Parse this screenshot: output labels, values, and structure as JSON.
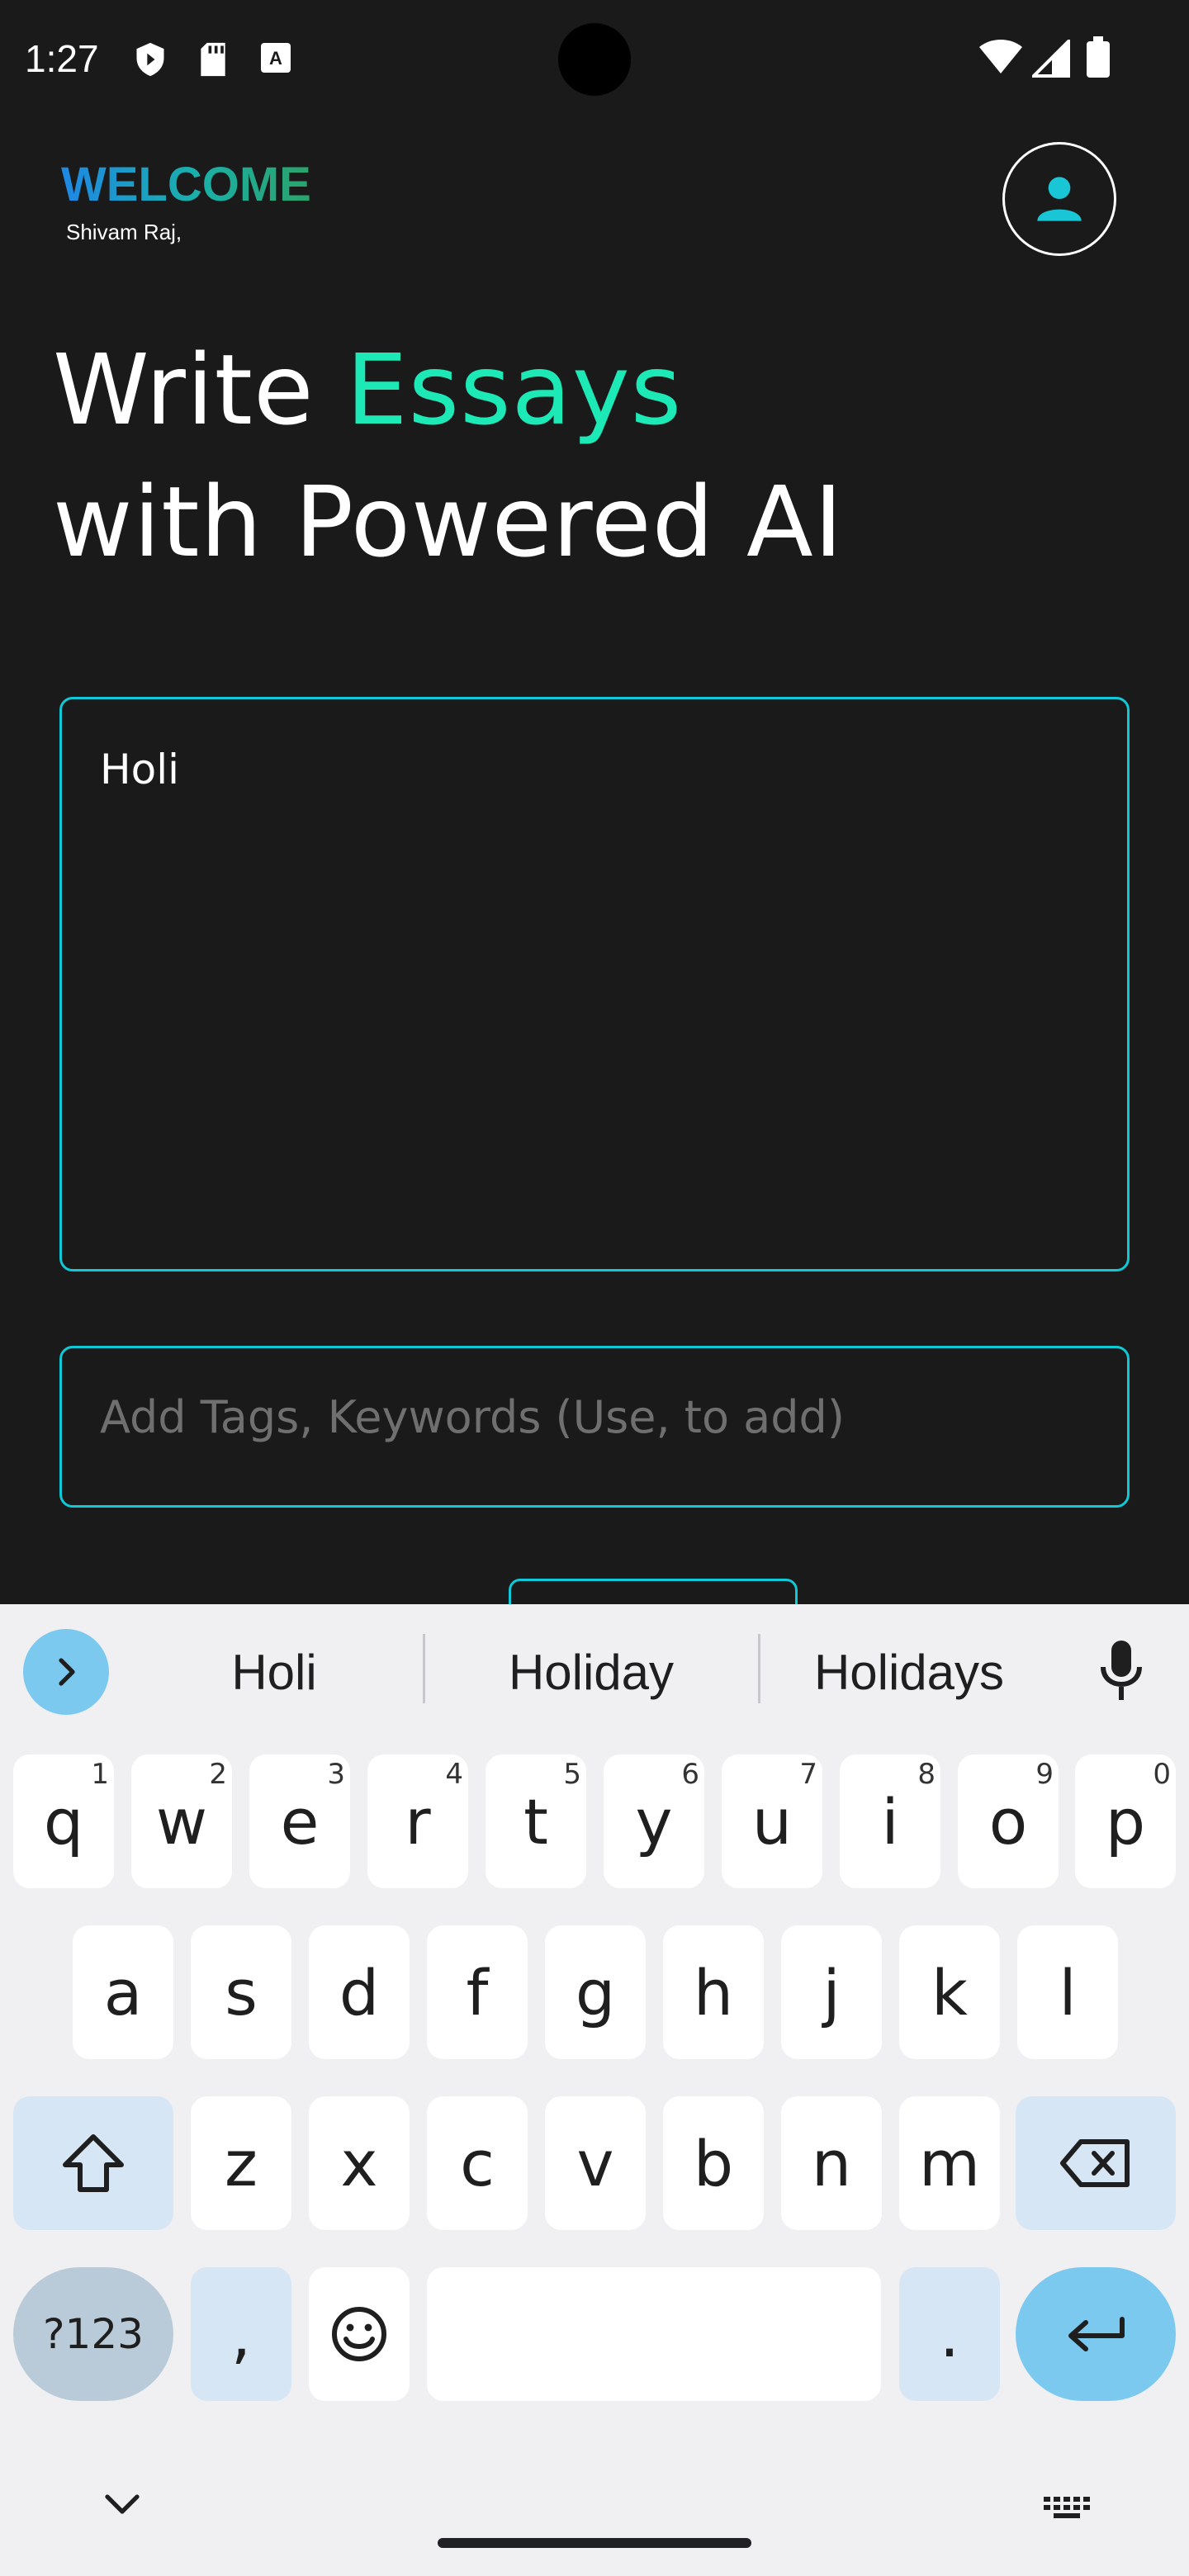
{
  "status_bar": {
    "time": "1:27",
    "left_icons": [
      "shield-icon",
      "sd-card-icon",
      "keyboard-a-icon"
    ],
    "right_icons": [
      "wifi-icon",
      "signal-icon",
      "battery-icon"
    ]
  },
  "header": {
    "welcome": "WELCOME",
    "username": "Shivam Raj,",
    "avatar_icon": "person-icon"
  },
  "headline": {
    "line1_prefix": "Write ",
    "line1_accent": "Essays",
    "line2": "with Powered AI"
  },
  "essay_input": {
    "value": "Holi"
  },
  "tags_input": {
    "placeholder": "Add Tags, Keywords (Use, to add)"
  },
  "keyboard": {
    "suggestions": [
      "Holi",
      "Holiday",
      "Holidays"
    ],
    "row1": [
      {
        "key": "q",
        "hint": "1"
      },
      {
        "key": "w",
        "hint": "2"
      },
      {
        "key": "e",
        "hint": "3"
      },
      {
        "key": "r",
        "hint": "4"
      },
      {
        "key": "t",
        "hint": "5"
      },
      {
        "key": "y",
        "hint": "6"
      },
      {
        "key": "u",
        "hint": "7"
      },
      {
        "key": "i",
        "hint": "8"
      },
      {
        "key": "o",
        "hint": "9"
      },
      {
        "key": "p",
        "hint": "0"
      }
    ],
    "row2": [
      "a",
      "s",
      "d",
      "f",
      "g",
      "h",
      "j",
      "k",
      "l"
    ],
    "row3": [
      "z",
      "x",
      "c",
      "v",
      "b",
      "n",
      "m"
    ],
    "symbols_label": "?123",
    "comma": ",",
    "period": "."
  },
  "colors": {
    "background": "#1a1a1b",
    "accent": "#1de9b6",
    "border": "#10c8d6",
    "keyboard_bg": "#f0f0f3"
  }
}
